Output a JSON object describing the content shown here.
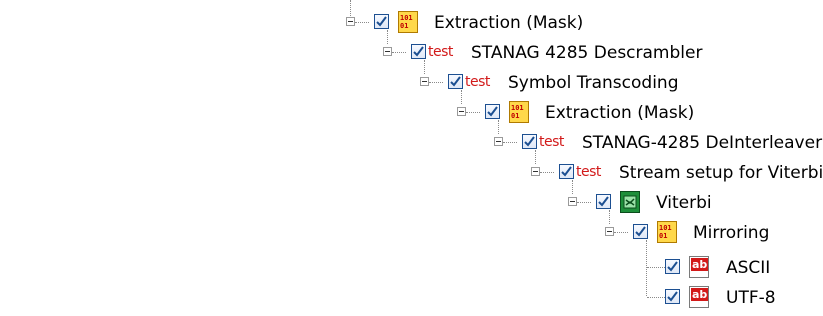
{
  "tree": {
    "nodes": [
      {
        "label": "Extraction (Mask)",
        "icon": "binary-extraction-icon",
        "checked": true,
        "expanded": true
      },
      {
        "label": "STANAG 4285 Descrambler",
        "icon": "test-icon",
        "icon_text": "test",
        "checked": true,
        "expanded": true
      },
      {
        "label": "Symbol Transcoding",
        "icon": "test-icon",
        "icon_text": "test",
        "checked": true,
        "expanded": true
      },
      {
        "label": "Extraction (Mask)",
        "icon": "binary-extraction-icon",
        "checked": true,
        "expanded": true
      },
      {
        "label": "STANAG-4285 DeInterleaver",
        "icon": "test-icon",
        "icon_text": "test",
        "checked": true,
        "expanded": true
      },
      {
        "label": "Stream setup for Viterbi",
        "icon": "test-icon",
        "icon_text": "test",
        "checked": true,
        "expanded": true
      },
      {
        "label": "Viterbi",
        "icon": "viterbi-icon",
        "checked": true,
        "expanded": true
      },
      {
        "label": "Mirroring",
        "icon": "binary-extraction-icon",
        "checked": true,
        "expanded": true
      },
      {
        "label": "ASCII",
        "icon": "text-ab-icon",
        "icon_text": "ab",
        "checked": true
      },
      {
        "label": "UTF-8",
        "icon": "text-ab-icon",
        "icon_text": "ab",
        "checked": true
      }
    ],
    "binary_icon_text": {
      "row1": "101",
      "row2": "01"
    }
  },
  "colors": {
    "check_border": "#1c4f91",
    "test_icon": "#d21a1a",
    "binary_icon_bg": "#ffd84a",
    "viterbi_icon_bg": "#1e8f3a",
    "ab_icon_bg": "#d31919"
  }
}
